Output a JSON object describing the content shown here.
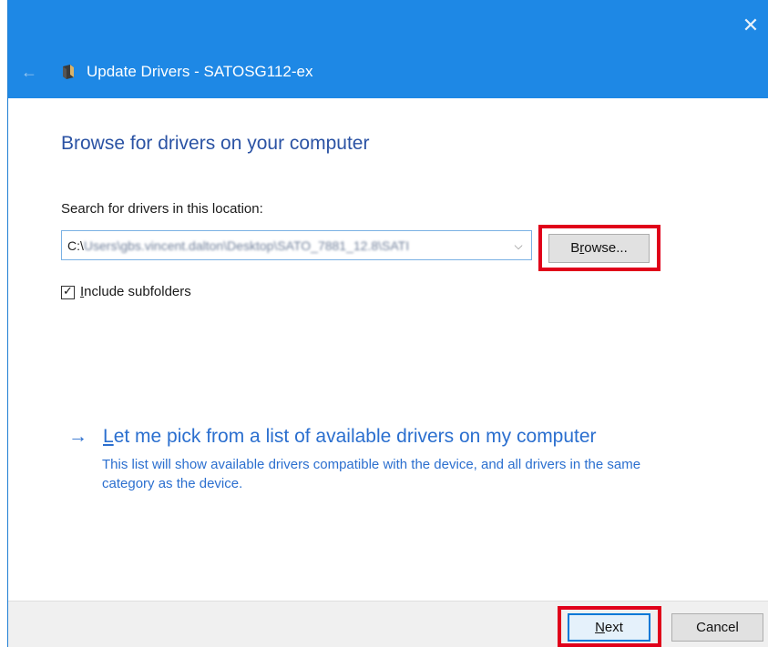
{
  "window": {
    "title": "Update Drivers - SATOSG112-ex",
    "close_glyph": "✕",
    "back_glyph": "←",
    "accent_color": "#1e88e5",
    "icons": [
      "back-arrow-icon",
      "device-icon",
      "close-icon"
    ]
  },
  "browse_page": {
    "heading": "Browse for drivers on your computer",
    "search_label": "Search for drivers in this location:",
    "path": {
      "prefix": "C:\\",
      "obscured": "Users\\gbs.vincent.dalton\\Desktop\\SATO_7881_12.8\\SATI",
      "dropdown_glyph": "⌵"
    },
    "browse_button": {
      "mnemonic": "r",
      "before": "B",
      "after": "owse..."
    },
    "include_subfolders": {
      "checked": true,
      "check_glyph": "✓",
      "mnemonic": "I",
      "rest": "nclude subfolders"
    },
    "pick_from_list": {
      "arrow_glyph": "→",
      "mnemonic": "L",
      "rest": "et me pick from a list of available drivers on my computer",
      "description": "This list will show available drivers compatible with the device, and all drivers in the same category as the device."
    }
  },
  "footer": {
    "next_button": {
      "mnemonic": "N",
      "rest": "ext"
    },
    "cancel_button": "Cancel"
  },
  "highlight_color": "#e0001a"
}
